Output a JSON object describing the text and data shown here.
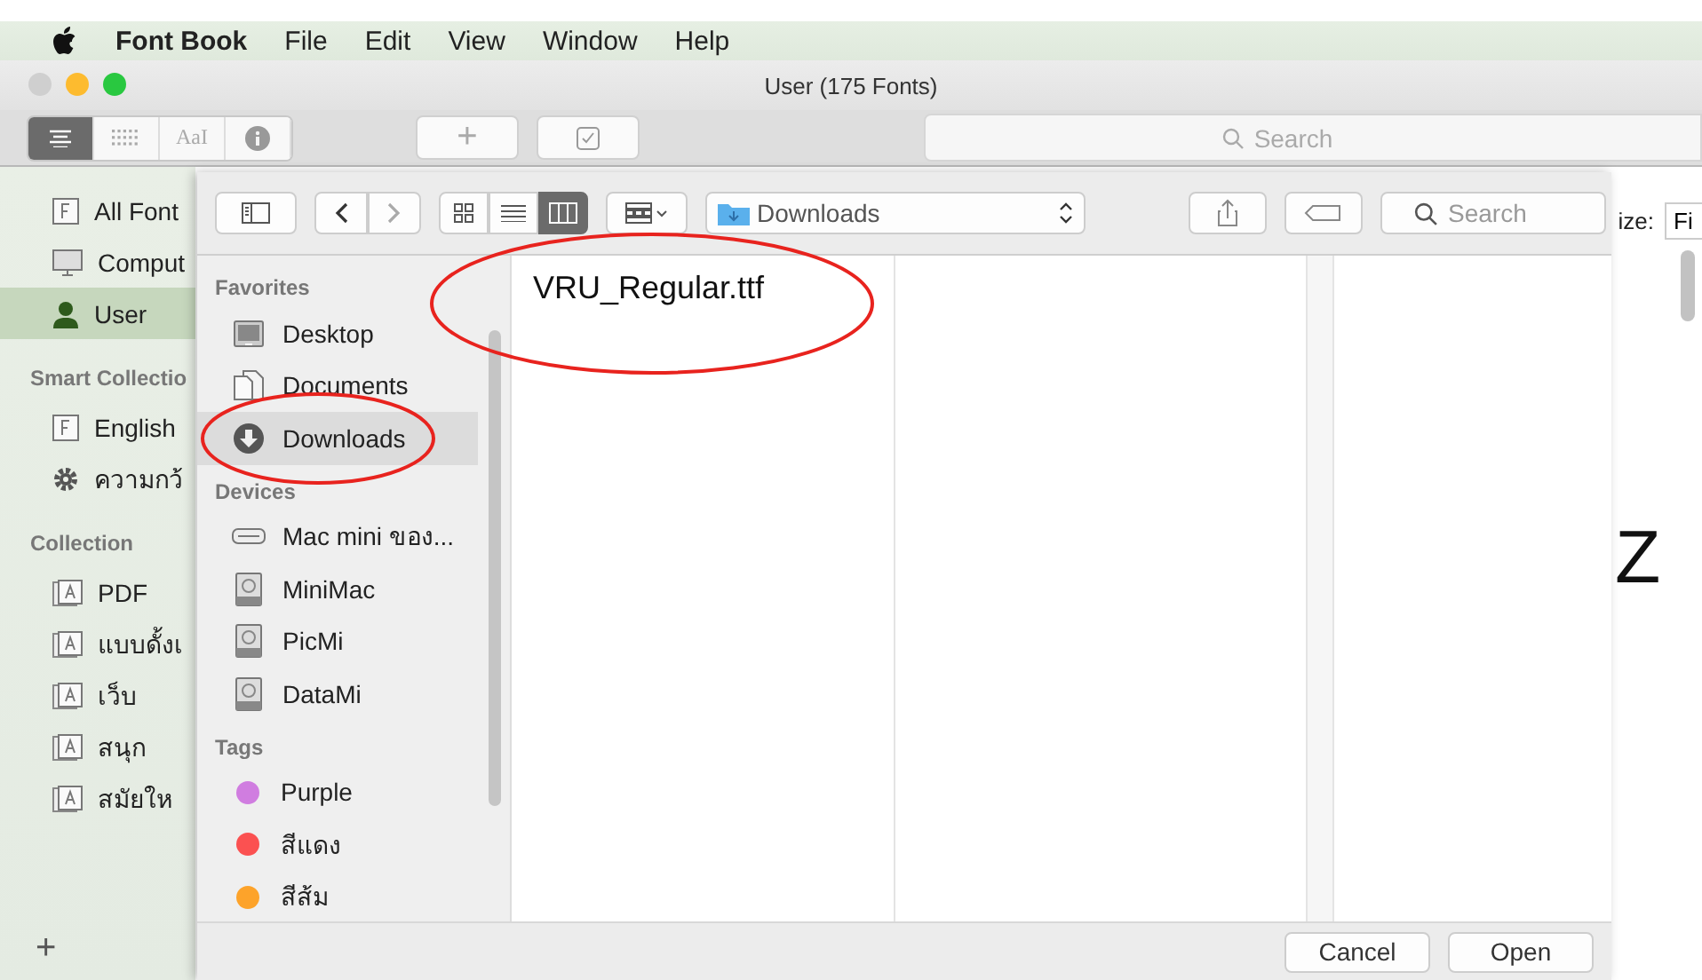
{
  "menu_bar": {
    "app": "Font Book",
    "items": [
      "File",
      "Edit",
      "View",
      "Window",
      "Help"
    ]
  },
  "window": {
    "title": "User (175 Fonts)"
  },
  "toolbar": {
    "view_modes": [
      {
        "kind": "list",
        "selected": true
      },
      {
        "kind": "grid",
        "selected": false
      },
      {
        "kind": "sample",
        "label": "AaI",
        "selected": false
      },
      {
        "kind": "info",
        "selected": false
      }
    ],
    "add_label": "+",
    "search": {
      "placeholder": "Search"
    }
  },
  "sidebar": {
    "sections": [
      {
        "items": [
          {
            "label": "All Font",
            "kind": "font",
            "selected": false
          },
          {
            "label": "Comput",
            "kind": "computer",
            "selected": false
          },
          {
            "label": "User",
            "kind": "user",
            "selected": true
          }
        ]
      },
      {
        "title": "Smart Collectio",
        "items": [
          {
            "label": "English",
            "kind": "font",
            "selected": false
          },
          {
            "label": "ความกว้",
            "kind": "gear",
            "selected": false
          }
        ]
      },
      {
        "title": "Collection",
        "items": [
          {
            "label": "PDF",
            "kind": "collection",
            "selected": false
          },
          {
            "label": "แบบดั้งเ",
            "kind": "collection",
            "selected": false
          },
          {
            "label": "เว็บ",
            "kind": "collection",
            "selected": false
          },
          {
            "label": "สนุก",
            "kind": "collection",
            "selected": false
          },
          {
            "label": "สมัยให",
            "kind": "collection",
            "selected": false
          }
        ]
      }
    ],
    "add_label": "+"
  },
  "preview": {
    "size_label": "ize:",
    "size_value": "Fi",
    "glyph": "Z"
  },
  "dialog": {
    "path": "Downloads",
    "search": {
      "placeholder": "Search"
    },
    "view_modes": [
      {
        "kind": "icon",
        "selected": false
      },
      {
        "kind": "list",
        "selected": false
      },
      {
        "kind": "column",
        "selected": true
      }
    ],
    "sidebar": [
      {
        "title": "Favorites",
        "items": [
          {
            "label": "Desktop",
            "kind": "desktop",
            "selected": false,
            "circled": false
          },
          {
            "label": "Documents",
            "kind": "document",
            "selected": false,
            "circled": false
          },
          {
            "label": "Downloads",
            "kind": "download",
            "selected": true,
            "circled": true
          }
        ]
      },
      {
        "title": "Devices",
        "items": [
          {
            "label": "Mac mini ของ...",
            "kind": "mac",
            "selected": false,
            "circled": false
          },
          {
            "label": "MiniMac",
            "kind": "disk",
            "selected": false,
            "circled": false
          },
          {
            "label": "PicMi",
            "kind": "disk",
            "selected": false,
            "circled": false
          },
          {
            "label": "DataMi",
            "kind": "disk",
            "selected": false,
            "circled": false
          }
        ]
      },
      {
        "title": "Tags",
        "items": [
          {
            "label": "Purple",
            "kind": "tag",
            "color": "#d07de0",
            "selected": false,
            "circled": false
          },
          {
            "label": "สีแดง",
            "kind": "tag",
            "color": "#fb5151",
            "selected": false,
            "circled": false
          },
          {
            "label": "สีส้ม",
            "kind": "tag",
            "color": "#fda32a",
            "selected": false,
            "circled": false
          }
        ]
      }
    ],
    "files": [
      {
        "name": "VRU_Regular.ttf",
        "circled": true
      }
    ],
    "buttons": [
      {
        "label": "Cancel"
      },
      {
        "label": "Open"
      }
    ]
  }
}
